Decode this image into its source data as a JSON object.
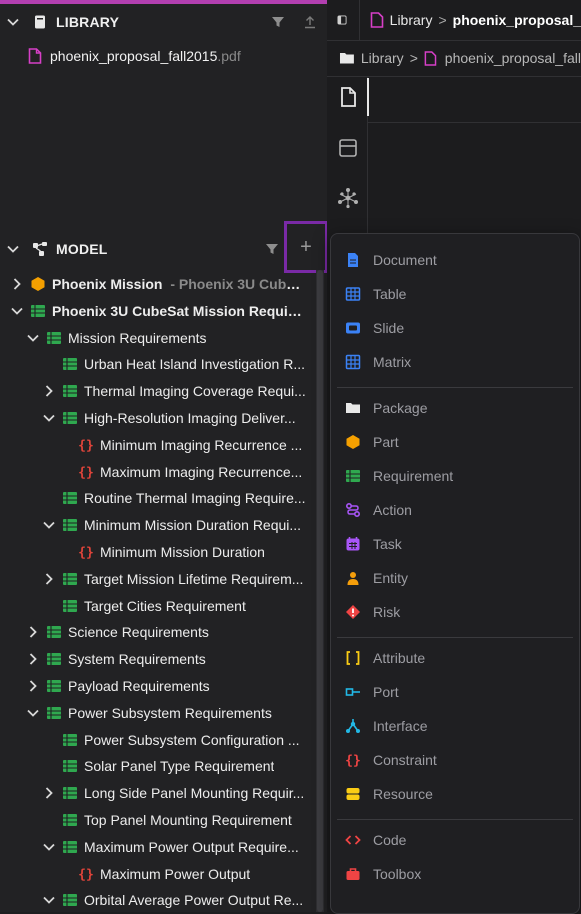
{
  "library": {
    "title": "LIBRARY",
    "file_name": "phoenix_proposal_fall2015",
    "file_ext": ".pdf"
  },
  "model": {
    "title": "MODEL",
    "add_symbol": "+"
  },
  "tree": [
    {
      "label": "Phoenix Mission",
      "sub": " - Phoenix 3U CubeSa...",
      "icon": "part",
      "chev": "right",
      "depth": 0,
      "bold": true
    },
    {
      "label": "Phoenix 3U CubeSat Mission Require...",
      "icon": "requirement",
      "chev": "down",
      "depth": 0,
      "bold": true
    },
    {
      "label": "Mission Requirements",
      "icon": "requirement",
      "chev": "down",
      "depth": 1
    },
    {
      "label": "Urban Heat Island Investigation R...",
      "icon": "requirement",
      "chev": "none",
      "depth": 2
    },
    {
      "label": "Thermal Imaging Coverage Requi...",
      "icon": "requirement",
      "chev": "right",
      "depth": 2
    },
    {
      "label": "High-Resolution Imaging Deliver...",
      "icon": "requirement",
      "chev": "down",
      "depth": 2
    },
    {
      "label": "Minimum Imaging Recurrence ...",
      "icon": "constraint",
      "chev": "none",
      "depth": 3
    },
    {
      "label": "Maximum Imaging Recurrence...",
      "icon": "constraint",
      "chev": "none",
      "depth": 3
    },
    {
      "label": "Routine Thermal Imaging Require...",
      "icon": "requirement",
      "chev": "none",
      "depth": 2
    },
    {
      "label": "Minimum Mission Duration Requi...",
      "icon": "requirement",
      "chev": "down",
      "depth": 2
    },
    {
      "label": "Minimum Mission Duration",
      "icon": "constraint",
      "chev": "none",
      "depth": 3
    },
    {
      "label": "Target Mission Lifetime Requirem...",
      "icon": "requirement",
      "chev": "right",
      "depth": 2
    },
    {
      "label": "Target Cities Requirement",
      "icon": "requirement",
      "chev": "none",
      "depth": 2
    },
    {
      "label": "Science Requirements",
      "icon": "requirement",
      "chev": "right",
      "depth": 1
    },
    {
      "label": "System Requirements",
      "icon": "requirement",
      "chev": "right",
      "depth": 1
    },
    {
      "label": "Payload Requirements",
      "icon": "requirement",
      "chev": "right",
      "depth": 1
    },
    {
      "label": "Power Subsystem Requirements",
      "icon": "requirement",
      "chev": "down",
      "depth": 1
    },
    {
      "label": "Power Subsystem Configuration ...",
      "icon": "requirement",
      "chev": "none",
      "depth": 2
    },
    {
      "label": "Solar Panel Type Requirement",
      "icon": "requirement",
      "chev": "none",
      "depth": 2
    },
    {
      "label": "Long Side Panel Mounting Requir...",
      "icon": "requirement",
      "chev": "right",
      "depth": 2
    },
    {
      "label": "Top Panel Mounting Requirement",
      "icon": "requirement",
      "chev": "none",
      "depth": 2
    },
    {
      "label": "Maximum Power Output Require...",
      "icon": "requirement",
      "chev": "down",
      "depth": 2
    },
    {
      "label": "Maximum Power Output",
      "icon": "constraint",
      "chev": "none",
      "depth": 3
    },
    {
      "label": "Orbital Average Power Output Re...",
      "icon": "requirement",
      "chev": "down",
      "depth": 2
    }
  ],
  "tab": {
    "crumb_root": "Library",
    "crumb_file": "phoenix_proposal_",
    "separator": ">"
  },
  "breadcrumb": {
    "root": "Library",
    "file": "phoenix_proposal_fall"
  },
  "menu": {
    "groups": [
      [
        {
          "label": "Document",
          "icon": "document",
          "color": "#3b82f6"
        },
        {
          "label": "Table",
          "icon": "table",
          "color": "#3b82f6"
        },
        {
          "label": "Slide",
          "icon": "slide",
          "color": "#3b82f6"
        },
        {
          "label": "Matrix",
          "icon": "matrix",
          "color": "#3b82f6"
        }
      ],
      [
        {
          "label": "Package",
          "icon": "folder",
          "color": "#e8e8e8"
        },
        {
          "label": "Part",
          "icon": "part",
          "color": "#f5a000"
        },
        {
          "label": "Requirement",
          "icon": "requirement",
          "color": "#2fa84f"
        },
        {
          "label": "Action",
          "icon": "action",
          "color": "#a855f7"
        },
        {
          "label": "Task",
          "icon": "task",
          "color": "#a855f7"
        },
        {
          "label": "Entity",
          "icon": "entity",
          "color": "#f59e0b"
        },
        {
          "label": "Risk",
          "icon": "risk",
          "color": "#ef4444"
        }
      ],
      [
        {
          "label": "Attribute",
          "icon": "attribute",
          "color": "#facc15"
        },
        {
          "label": "Port",
          "icon": "port",
          "color": "#22b8e6"
        },
        {
          "label": "Interface",
          "icon": "interface",
          "color": "#22b8e6"
        },
        {
          "label": "Constraint",
          "icon": "constraint",
          "color": "#ef4444"
        },
        {
          "label": "Resource",
          "icon": "resource",
          "color": "#facc15"
        }
      ],
      [
        {
          "label": "Code",
          "icon": "code",
          "color": "#ef4444"
        },
        {
          "label": "Toolbox",
          "icon": "toolbox",
          "color": "#ef4444"
        }
      ]
    ]
  },
  "colors": {
    "accent": "#b23fb0",
    "highlight_box": "#7a2aa6",
    "requirement": "#2fa84f",
    "constraint": "#e0443a",
    "file": "#d63fc7"
  }
}
